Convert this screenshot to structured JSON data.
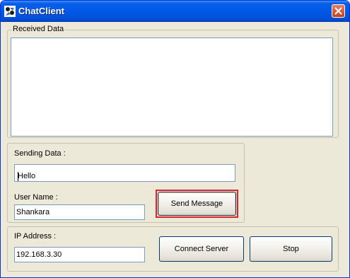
{
  "window": {
    "title": "ChatClient",
    "icons": {
      "app": "chat-app-icon",
      "close": "close-icon"
    },
    "colors": {
      "titlebar": "#0058e6",
      "face": "#ece9d8",
      "highlight": "#d7232b"
    }
  },
  "received": {
    "caption": "Received Data",
    "content": ""
  },
  "sending": {
    "label": "Sending Data :",
    "message_value": "Hello",
    "user_label": "User Name :",
    "user_value": "Shankara",
    "send_button": "Send Message"
  },
  "connection": {
    "ip_label": "IP Address :",
    "ip_value": "192.168.3.30",
    "connect_button": "Connect Server",
    "stop_button": "Stop"
  }
}
